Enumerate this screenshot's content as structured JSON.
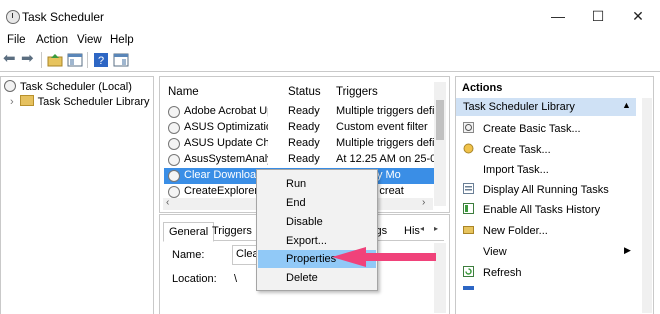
{
  "window": {
    "title": "Task Scheduler",
    "controls": {
      "minimize": "—",
      "maximize": "☐",
      "close": "✕"
    }
  },
  "menu": [
    "File",
    "Action",
    "View",
    "Help"
  ],
  "tree": {
    "root": "Task Scheduler (Local)",
    "library": "Task Scheduler Library",
    "expander": "›"
  },
  "list": {
    "headers": [
      "Name",
      "Status",
      "Triggers"
    ],
    "rows": [
      {
        "name": "Adobe Acrobat Updat...",
        "status": "Ready",
        "trigger": "Multiple triggers defir"
      },
      {
        "name": "ASUS Optimization 3...",
        "status": "Ready",
        "trigger": "Custom event filter"
      },
      {
        "name": "ASUS Update Checker...",
        "status": "Ready",
        "trigger": "Multiple triggers defir"
      },
      {
        "name": "AsusSystemAnalysis_...",
        "status": "Ready",
        "trigger": "At 12.25 AM on 25-01-"
      },
      {
        "name": "Clear Downloads",
        "status": "",
        "trigger": "AM every Mo"
      },
      {
        "name": "CreateExplorerSh",
        "status": "",
        "trigger": "e task is creat"
      }
    ]
  },
  "detail": {
    "tabs": [
      "General",
      "Triggers",
      "ings",
      "His"
    ],
    "name_label": "Name:",
    "name_value": "Clear",
    "location_label": "Location:",
    "location_value": "\\"
  },
  "actions": {
    "header": "Actions",
    "section": "Task Scheduler Library",
    "items": [
      "Create Basic Task...",
      "Create Task...",
      "Import Task...",
      "Display All Running Tasks",
      "Enable All Tasks History",
      "New Folder...",
      "View",
      "Refresh"
    ]
  },
  "context_menu": {
    "items": [
      "Run",
      "End",
      "Disable",
      "Export...",
      "Properties",
      "Delete"
    ],
    "highlighted": "Properties"
  },
  "colors": {
    "selection": "#3a8ee6",
    "menu_highlight": "#91c9f7",
    "arrow": "#f0427a"
  }
}
